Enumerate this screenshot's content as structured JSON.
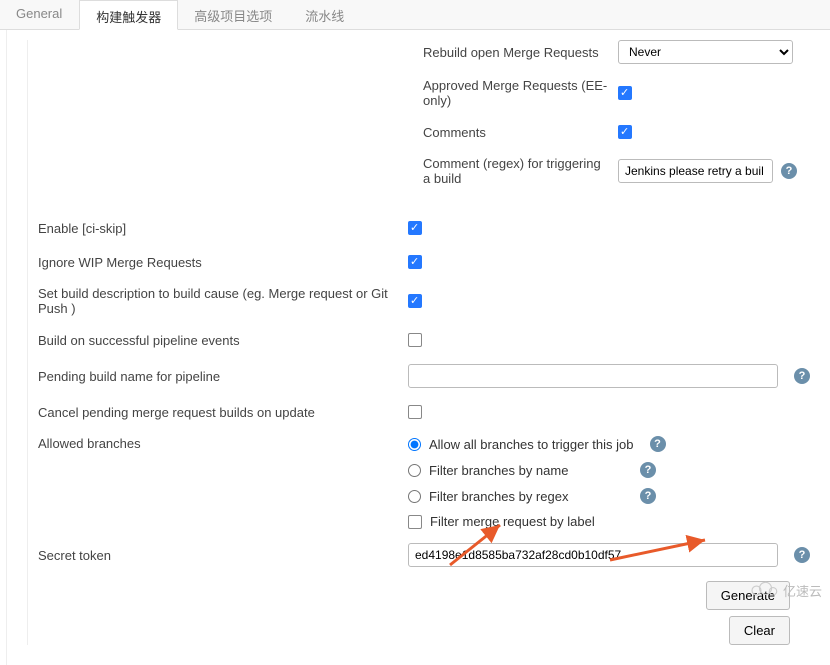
{
  "tabs": {
    "general": "General",
    "triggers": "构建触发器",
    "advanced": "高级项目选项",
    "pipeline": "流水线"
  },
  "indented": {
    "rebuildOpen": {
      "label": "Rebuild open Merge Requests",
      "value": "Never"
    },
    "approved": {
      "label": "Approved Merge Requests (EE-only)",
      "checked": true
    },
    "comments": {
      "label": "Comments",
      "checked": true
    },
    "commentRegex": {
      "label": "Comment (regex) for triggering a build",
      "value": "Jenkins please retry a buil"
    }
  },
  "opts": {
    "enableCiSkip": {
      "label": "Enable [ci-skip]",
      "checked": true
    },
    "ignoreWip": {
      "label": "Ignore WIP Merge Requests",
      "checked": true
    },
    "setBuildDesc": {
      "label": "Set build description to build cause (eg. Merge request or Git Push )",
      "checked": true
    },
    "buildSuccess": {
      "label": "Build on successful pipeline events",
      "checked": false
    },
    "pendingBuild": {
      "label": "Pending build name for pipeline",
      "value": ""
    },
    "cancelPending": {
      "label": "Cancel pending merge request builds on update",
      "checked": false
    }
  },
  "allowed": {
    "label": "Allowed branches",
    "all": "Allow all branches to trigger this job",
    "byName": "Filter branches by name",
    "byRegex": "Filter branches by regex",
    "byLabel": "Filter merge request by label"
  },
  "secret": {
    "label": "Secret token",
    "value": "ed4198e1d8585ba732af28cd0b10df57",
    "generate": "Generate",
    "clear": "Clear"
  },
  "watermark": "亿速云"
}
